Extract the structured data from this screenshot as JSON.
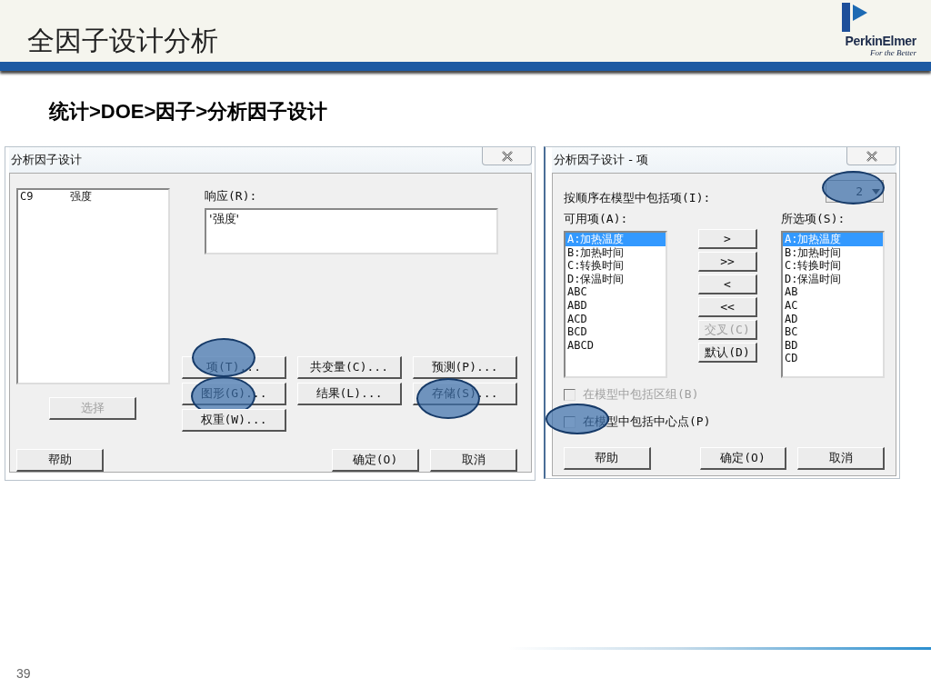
{
  "slide": {
    "title": "全因子设计分析",
    "logo": {
      "name": "PerkinElmer",
      "tagline": "For the Better"
    },
    "breadcrumb": "统计>DOE>因子>分析因子设计",
    "page_number": "39"
  },
  "dialog_main": {
    "title": "分析因子设计",
    "columns": [
      {
        "id_label": "C9",
        "name": "强度",
        "selected": false
      }
    ],
    "select_button": {
      "label": "选择",
      "disabled": true
    },
    "response": {
      "label": "响应(R):",
      "value": "'强度'"
    },
    "option_buttons": [
      {
        "label": "项(T)...",
        "highlighted": true
      },
      {
        "label": "共变量(C)...",
        "highlighted": false
      },
      {
        "label": "预测(P)...",
        "highlighted": false
      },
      {
        "label": "图形(G)...",
        "highlighted": true
      },
      {
        "label": "结果(L)...",
        "highlighted": false
      },
      {
        "label": "存储(S)...",
        "highlighted": true
      },
      {
        "label": "权重(W)...",
        "highlighted": false
      }
    ],
    "buttons": [
      "帮助",
      "确定(O)",
      "取消"
    ]
  },
  "dialog_terms": {
    "title": "分析因子设计 - 项",
    "order_label": "按顺序在模型中包括项(I):",
    "order_value": {
      "value": "2",
      "highlighted": true
    },
    "available_label": "可用项(A):",
    "available": [
      {
        "label": "A:加热温度",
        "selected": true
      },
      {
        "label": "B:加热时间",
        "selected": false
      },
      {
        "label": "C:转换时间",
        "selected": false
      },
      {
        "label": "D:保温时间",
        "selected": false
      },
      {
        "label": "ABC",
        "selected": false
      },
      {
        "label": "ABD",
        "selected": false
      },
      {
        "label": "ACD",
        "selected": false
      },
      {
        "label": "BCD",
        "selected": false
      },
      {
        "label": "ABCD",
        "selected": false
      }
    ],
    "move_buttons": [
      {
        "label": ">",
        "disabled": false
      },
      {
        "label": ">>",
        "disabled": false
      },
      {
        "label": "<",
        "disabled": false
      },
      {
        "label": "<<",
        "disabled": false
      },
      {
        "label": "交叉(C)",
        "disabled": true
      },
      {
        "label": "默认(D)",
        "disabled": false
      }
    ],
    "selected_label": "所选项(S):",
    "selected_terms": [
      {
        "label": "A:加热温度",
        "selected": true
      },
      {
        "label": "B:加热时间",
        "selected": false
      },
      {
        "label": "C:转换时间",
        "selected": false
      },
      {
        "label": "D:保温时间",
        "selected": false
      },
      {
        "label": "AB",
        "selected": false
      },
      {
        "label": "AC",
        "selected": false
      },
      {
        "label": "AD",
        "selected": false
      },
      {
        "label": "BC",
        "selected": false
      },
      {
        "label": "BD",
        "selected": false
      },
      {
        "label": "CD",
        "selected": false
      }
    ],
    "checkboxes": [
      {
        "label": "在模型中包括区组(B)",
        "checked": false,
        "disabled": true,
        "highlighted": false
      },
      {
        "label": "在模型中包括中心点(P)",
        "checked": false,
        "disabled": false,
        "highlighted": true
      }
    ],
    "buttons": [
      "帮助",
      "确定(O)",
      "取消"
    ]
  }
}
